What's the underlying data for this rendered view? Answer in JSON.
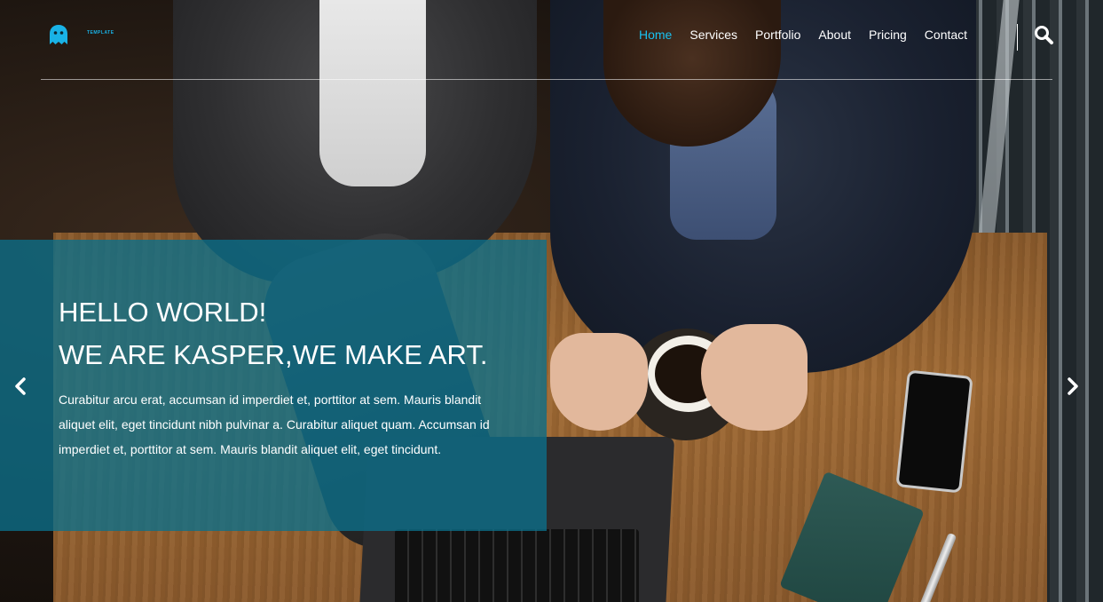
{
  "logo": {
    "text": "TEMPLATE",
    "icon": "ghost-icon",
    "color": "#19b2e6"
  },
  "nav": {
    "items": [
      {
        "label": "Home",
        "active": true
      },
      {
        "label": "Services",
        "active": false
      },
      {
        "label": "Portfolio",
        "active": false
      },
      {
        "label": "About",
        "active": false
      },
      {
        "label": "Pricing",
        "active": false
      },
      {
        "label": "Contact",
        "active": false
      }
    ],
    "search_icon": "search-icon",
    "active_color": "#19c1f0"
  },
  "hero": {
    "title_line1": "HELLO WORLD!",
    "title_line2": "WE ARE KASPER,WE MAKE ART.",
    "text": "Curabitur arcu erat, accumsan id imperdiet et, porttitor at sem. Mauris blandit aliquet elit, eget tincidunt nibh pulvinar a. Curabitur aliquet quam. Accumsan id imperdiet et, porttitor at sem. Mauris blandit aliquet elit, eget tincidunt.",
    "overlay_color": "#0b708a"
  },
  "slider": {
    "prev_icon": "chevron-left-icon",
    "next_icon": "chevron-right-icon"
  }
}
